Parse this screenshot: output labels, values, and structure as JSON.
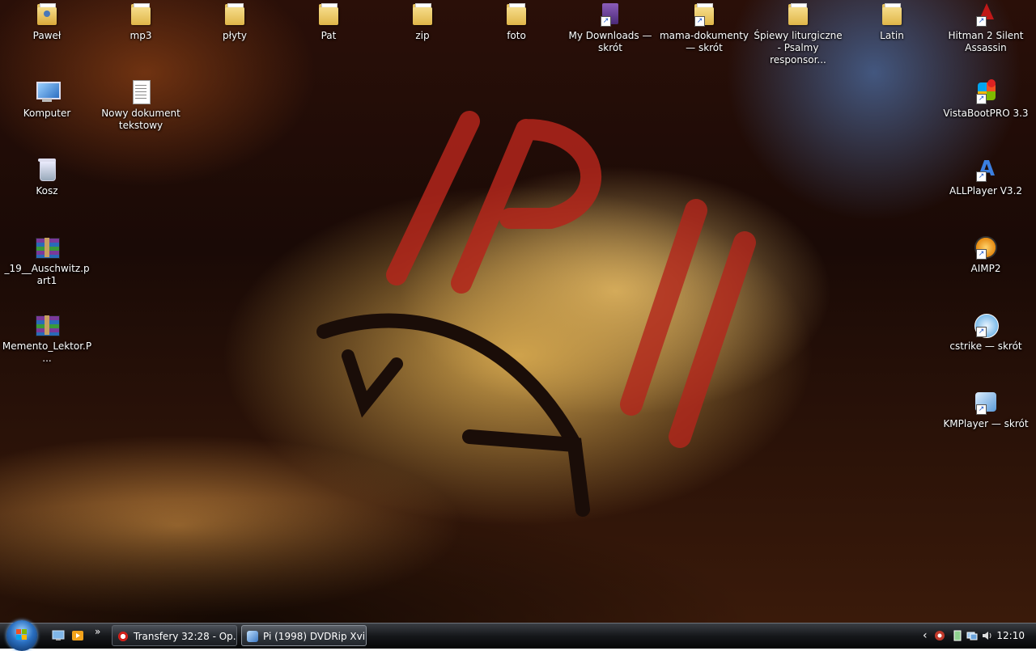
{
  "desktop": {
    "icons": [
      {
        "label": "Paweł",
        "icon": "user-folder-icon"
      },
      {
        "label": "mp3",
        "icon": "folder-icon"
      },
      {
        "label": "płyty",
        "icon": "folder-icon"
      },
      {
        "label": "Pat",
        "icon": "folder-icon"
      },
      {
        "label": "zip",
        "icon": "folder-icon"
      },
      {
        "label": "foto",
        "icon": "folder-icon"
      },
      {
        "label": "My Downloads — skrót",
        "icon": "downloads-shortcut-icon"
      },
      {
        "label": "mama-dokumenty — skrót",
        "icon": "folder-shortcut-icon"
      },
      {
        "label": "Śpiewy liturgiczne - Psalmy responsor...",
        "icon": "folder-icon"
      },
      {
        "label": "Latin",
        "icon": "folder-icon"
      },
      {
        "label": "Hitman 2 Silent Assassin",
        "icon": "hitman-shortcut-icon"
      },
      {
        "label": "Komputer",
        "icon": "computer-icon"
      },
      {
        "label": "Nowy dokument tekstowy",
        "icon": "text-document-icon"
      },
      {
        "label": "VistaBootPRO 3.3",
        "icon": "vistaboot-shortcut-icon"
      },
      {
        "label": "Kosz",
        "icon": "recycle-bin-icon"
      },
      {
        "label": "ALLPlayer V3.2",
        "icon": "allplayer-shortcut-icon"
      },
      {
        "label": "_19__Auschwitz.part1",
        "icon": "rar-archive-icon"
      },
      {
        "label": "AIMP2",
        "icon": "aimp-shortcut-icon"
      },
      {
        "label": "Memento_Lektor.P...",
        "icon": "rar-archive-icon"
      },
      {
        "label": "cstrike — skrót",
        "icon": "cstrike-shortcut-icon"
      },
      {
        "label": "KMPlayer — skrót",
        "icon": "kmplayer-shortcut-icon"
      }
    ]
  },
  "taskbar": {
    "start_label": "Start",
    "tasks": [
      {
        "label": "Transfery 32:28 - Op...",
        "icon": "opera-icon",
        "active": false
      },
      {
        "label": "Pi (1998) DVDRip Xvi...",
        "icon": "video-player-icon",
        "active": true
      }
    ],
    "chevron": "»",
    "tray_chevron": "‹",
    "clock": "12:10"
  },
  "colors": {
    "icon_label": "#ffffff",
    "folder": "#f2d27a",
    "taskbar": "#15171a"
  }
}
